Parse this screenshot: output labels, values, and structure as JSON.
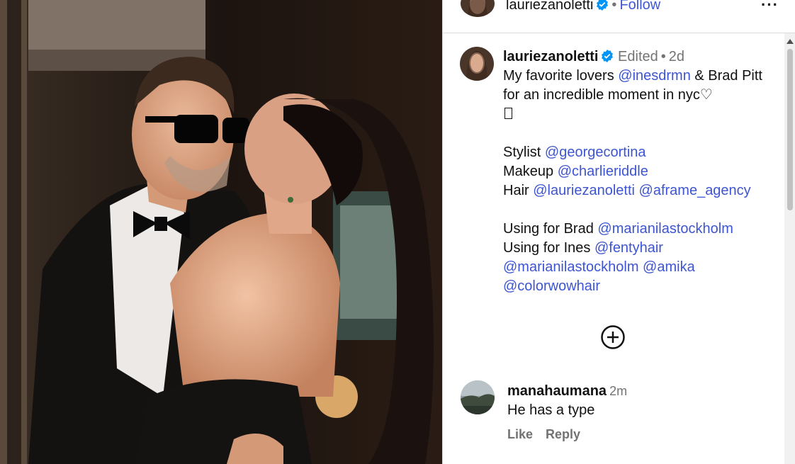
{
  "header": {
    "username": "lauriezanoletti",
    "separator": "•",
    "follow_label": "Follow",
    "more_label": "···"
  },
  "caption": {
    "username": "lauriezanoletti",
    "edited": "Edited",
    "separator": "•",
    "age": "2d",
    "line1_text_a": "My favorite lovers ",
    "line1_mention": "@inesdrmn",
    "line1_text_b": " & Brad Pitt for an incredible moment in nyc",
    "heart_glyph": "♡",
    "stylist_label": "Stylist ",
    "stylist_mention": "@georgecortina",
    "makeup_label": "Makeup ",
    "makeup_mention": "@charlieriddle",
    "hair_label": "Hair ",
    "hair_mention_1": "@lauriezanoletti",
    "hair_mention_2": "@aframe_agency",
    "brad_label": "Using for Brad ",
    "brad_mention": "@marianilastockholm",
    "ines_label": "Using for Ines ",
    "ines_mention_1": "@fentyhair",
    "ines_mention_2": "@marianilastockholm",
    "ines_mention_3": "@amika",
    "ines_mention_4": "@colorwowhair"
  },
  "comment": {
    "username": "manahaumana",
    "age": "2m",
    "text": "He has a type",
    "like_label": "Like",
    "reply_label": "Reply"
  },
  "icons": {
    "verified": "verified-badge-icon",
    "more": "more-options-icon",
    "load_more": "plus-circle-icon"
  },
  "colors": {
    "mention": "#3d55d1",
    "follow": "#3e57d6",
    "verified": "#0095f6",
    "muted": "#737373"
  }
}
